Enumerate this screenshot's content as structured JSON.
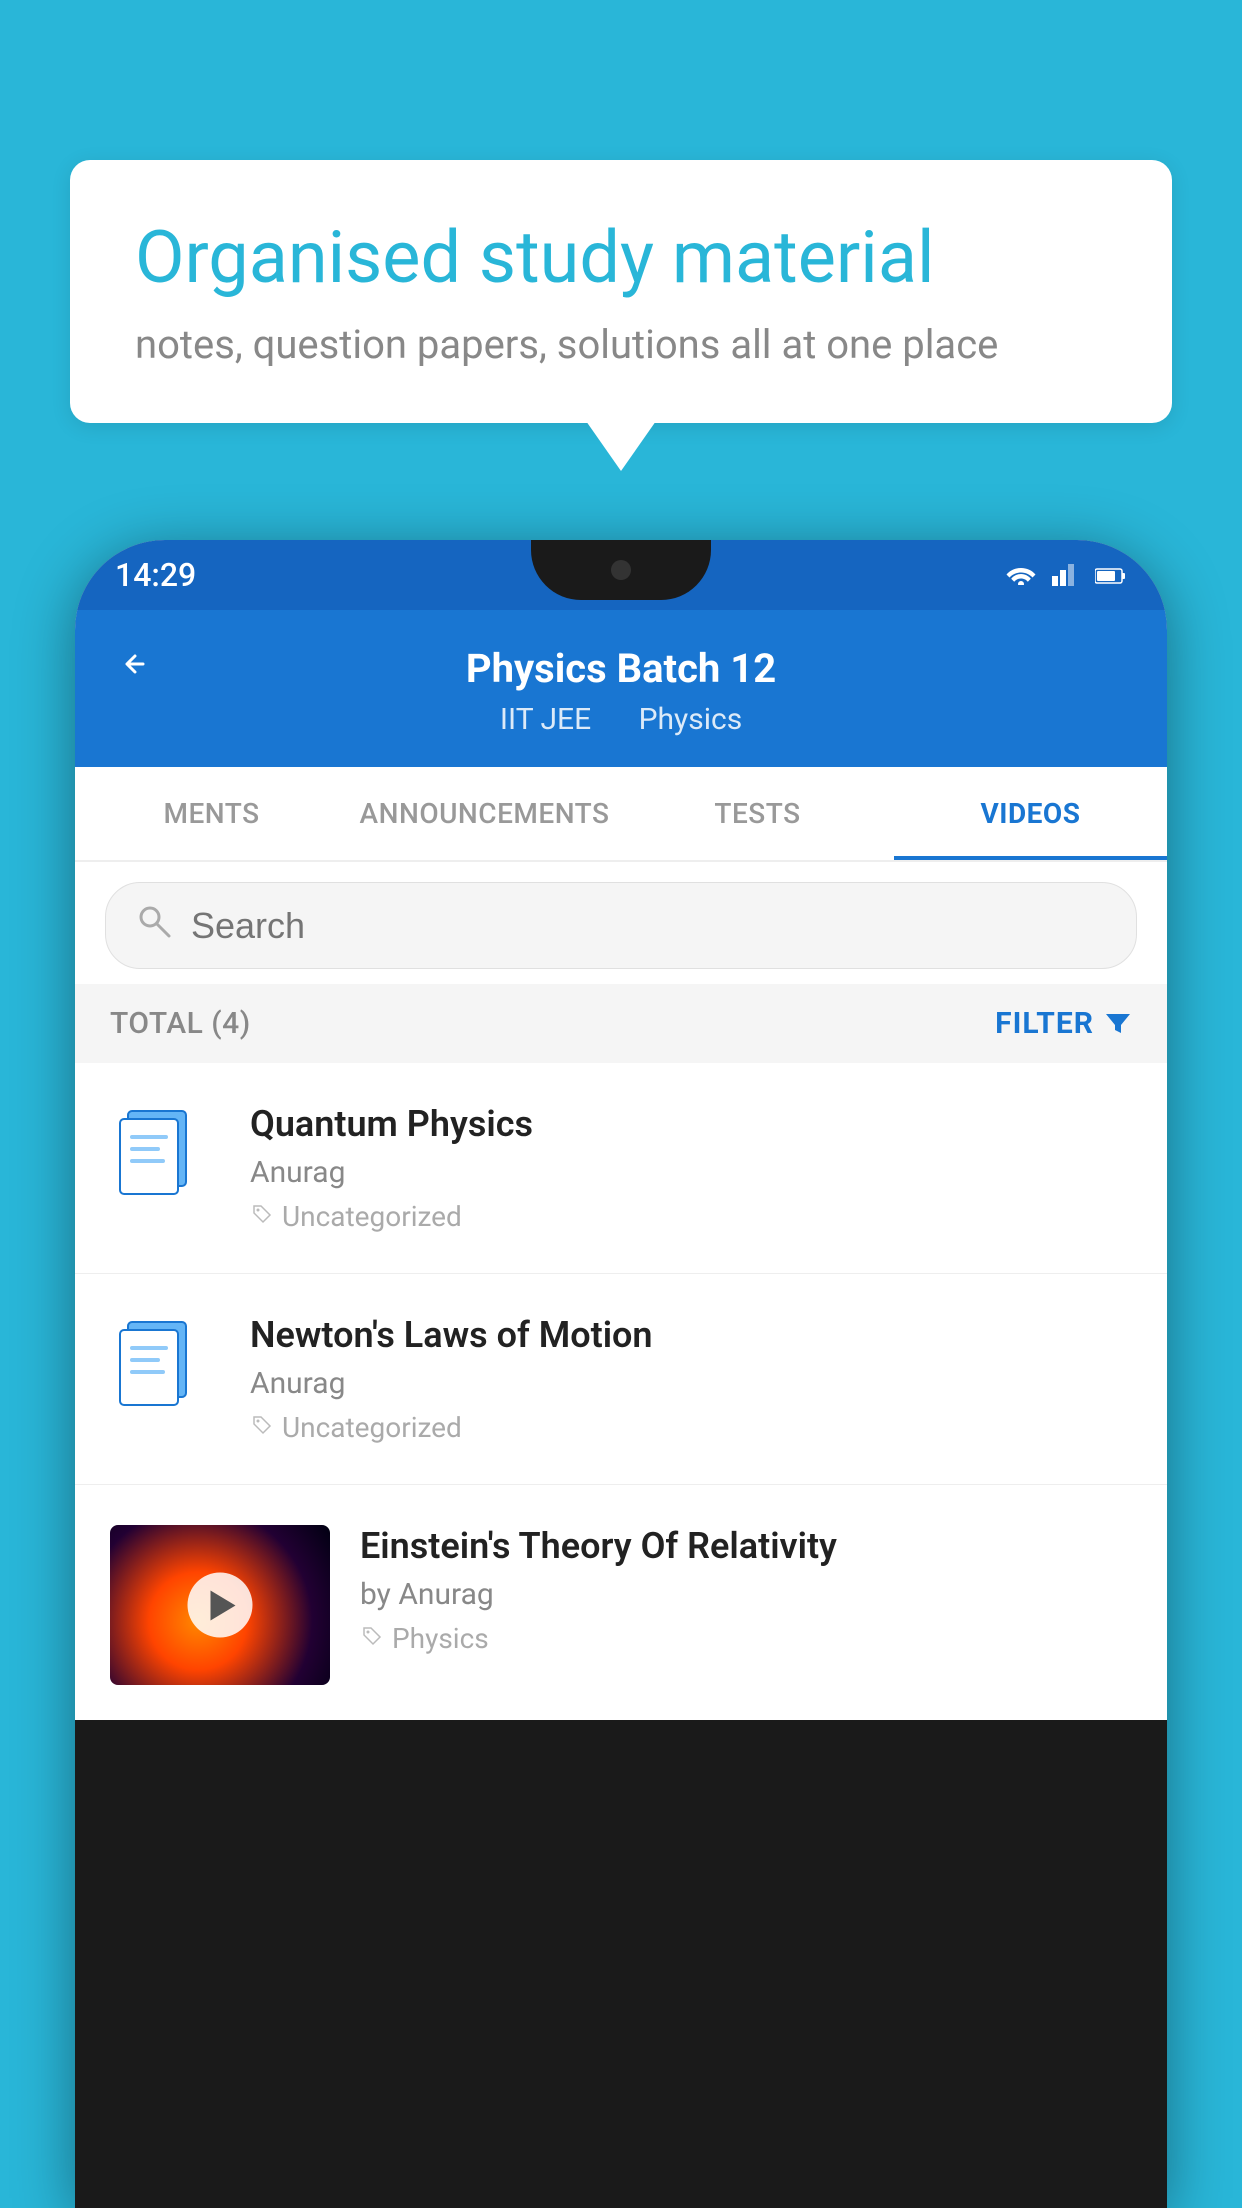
{
  "background_color": "#29b6d8",
  "speech_bubble": {
    "title": "Organised study material",
    "subtitle": "notes, question papers, solutions all at one place"
  },
  "status_bar": {
    "time": "14:29",
    "icons": [
      "wifi",
      "signal",
      "battery"
    ]
  },
  "app_header": {
    "title": "Physics Batch 12",
    "subtitle_1": "IIT JEE",
    "subtitle_2": "Physics"
  },
  "tabs": [
    {
      "label": "MENTS",
      "active": false
    },
    {
      "label": "ANNOUNCEMENTS",
      "active": false
    },
    {
      "label": "TESTS",
      "active": false
    },
    {
      "label": "VIDEOS",
      "active": true
    }
  ],
  "search": {
    "placeholder": "Search"
  },
  "filter_row": {
    "total_label": "TOTAL (4)",
    "filter_label": "FILTER"
  },
  "videos": [
    {
      "title": "Quantum Physics",
      "author": "Anurag",
      "tag": "Uncategorized",
      "has_thumbnail": false
    },
    {
      "title": "Newton's Laws of Motion",
      "author": "Anurag",
      "tag": "Uncategorized",
      "has_thumbnail": false
    },
    {
      "title": "Einstein's Theory Of Relativity",
      "author": "by Anurag",
      "tag": "Physics",
      "has_thumbnail": true
    }
  ]
}
